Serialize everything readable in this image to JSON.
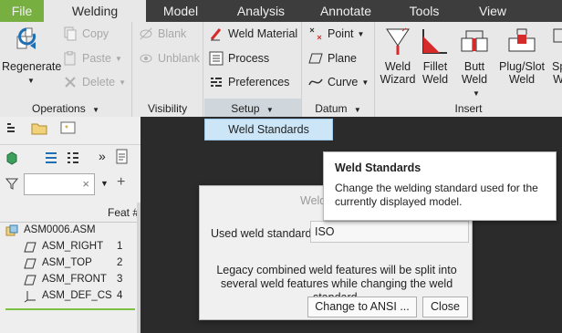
{
  "menubar": {
    "tabs": [
      {
        "label": "File"
      },
      {
        "label": "Welding"
      },
      {
        "label": "Model"
      },
      {
        "label": "Analysis"
      },
      {
        "label": "Annotate"
      },
      {
        "label": "Tools"
      },
      {
        "label": "View"
      }
    ]
  },
  "ribbon": {
    "regenerate": "Regenerate",
    "operations": {
      "label": "Operations",
      "copy": "Copy",
      "paste": "Paste",
      "delete": "Delete"
    },
    "visibility": {
      "label": "Visibility",
      "blank": "Blank",
      "unblank": "Unblank"
    },
    "setup": {
      "label": "Setup",
      "weld_material": "Weld Material",
      "process": "Process",
      "preferences": "Preferences"
    },
    "datum": {
      "label": "Datum",
      "point": "Point",
      "plane": "Plane",
      "curve": "Curve"
    },
    "insert": {
      "label": "Insert",
      "weld_wizard": [
        "Weld",
        "Wizard"
      ],
      "fillet_weld": [
        "Fillet",
        "Weld"
      ],
      "butt_weld": [
        "Butt",
        "Weld"
      ],
      "plug_slot_weld": [
        "Plug/Slot",
        "Weld"
      ],
      "partial": [
        "Sp",
        "W"
      ]
    }
  },
  "dropdown": {
    "weld_standards": "Weld Standards"
  },
  "tree": {
    "feat_header": "Feat #",
    "items": [
      {
        "label": "ASM0006.ASM",
        "num": ""
      },
      {
        "label": "ASM_RIGHT",
        "num": "1"
      },
      {
        "label": "ASM_TOP",
        "num": "2"
      },
      {
        "label": "ASM_FRONT",
        "num": "3"
      },
      {
        "label": "ASM_DEF_CS",
        "num": "4"
      }
    ]
  },
  "dialog": {
    "title": "Weld",
    "field_label": "Used weld standard",
    "field_value": "ISO",
    "note": "Legacy combined weld features will be split into several weld features while changing the weld standard.",
    "change_button": "Change to ANSI ...",
    "close_button": "Close"
  },
  "tooltip": {
    "title": "Weld Standards",
    "body": "Change the welding standard used for the currently displayed model."
  },
  "colors": {
    "file_tab": "#77b041",
    "menubar": "#3d3d3d",
    "ribbon": "#e8e8e8",
    "canvas": "#2b2b2b",
    "dropdown_highlight": "#cde6f7",
    "weld_red": "#d62b2b"
  }
}
